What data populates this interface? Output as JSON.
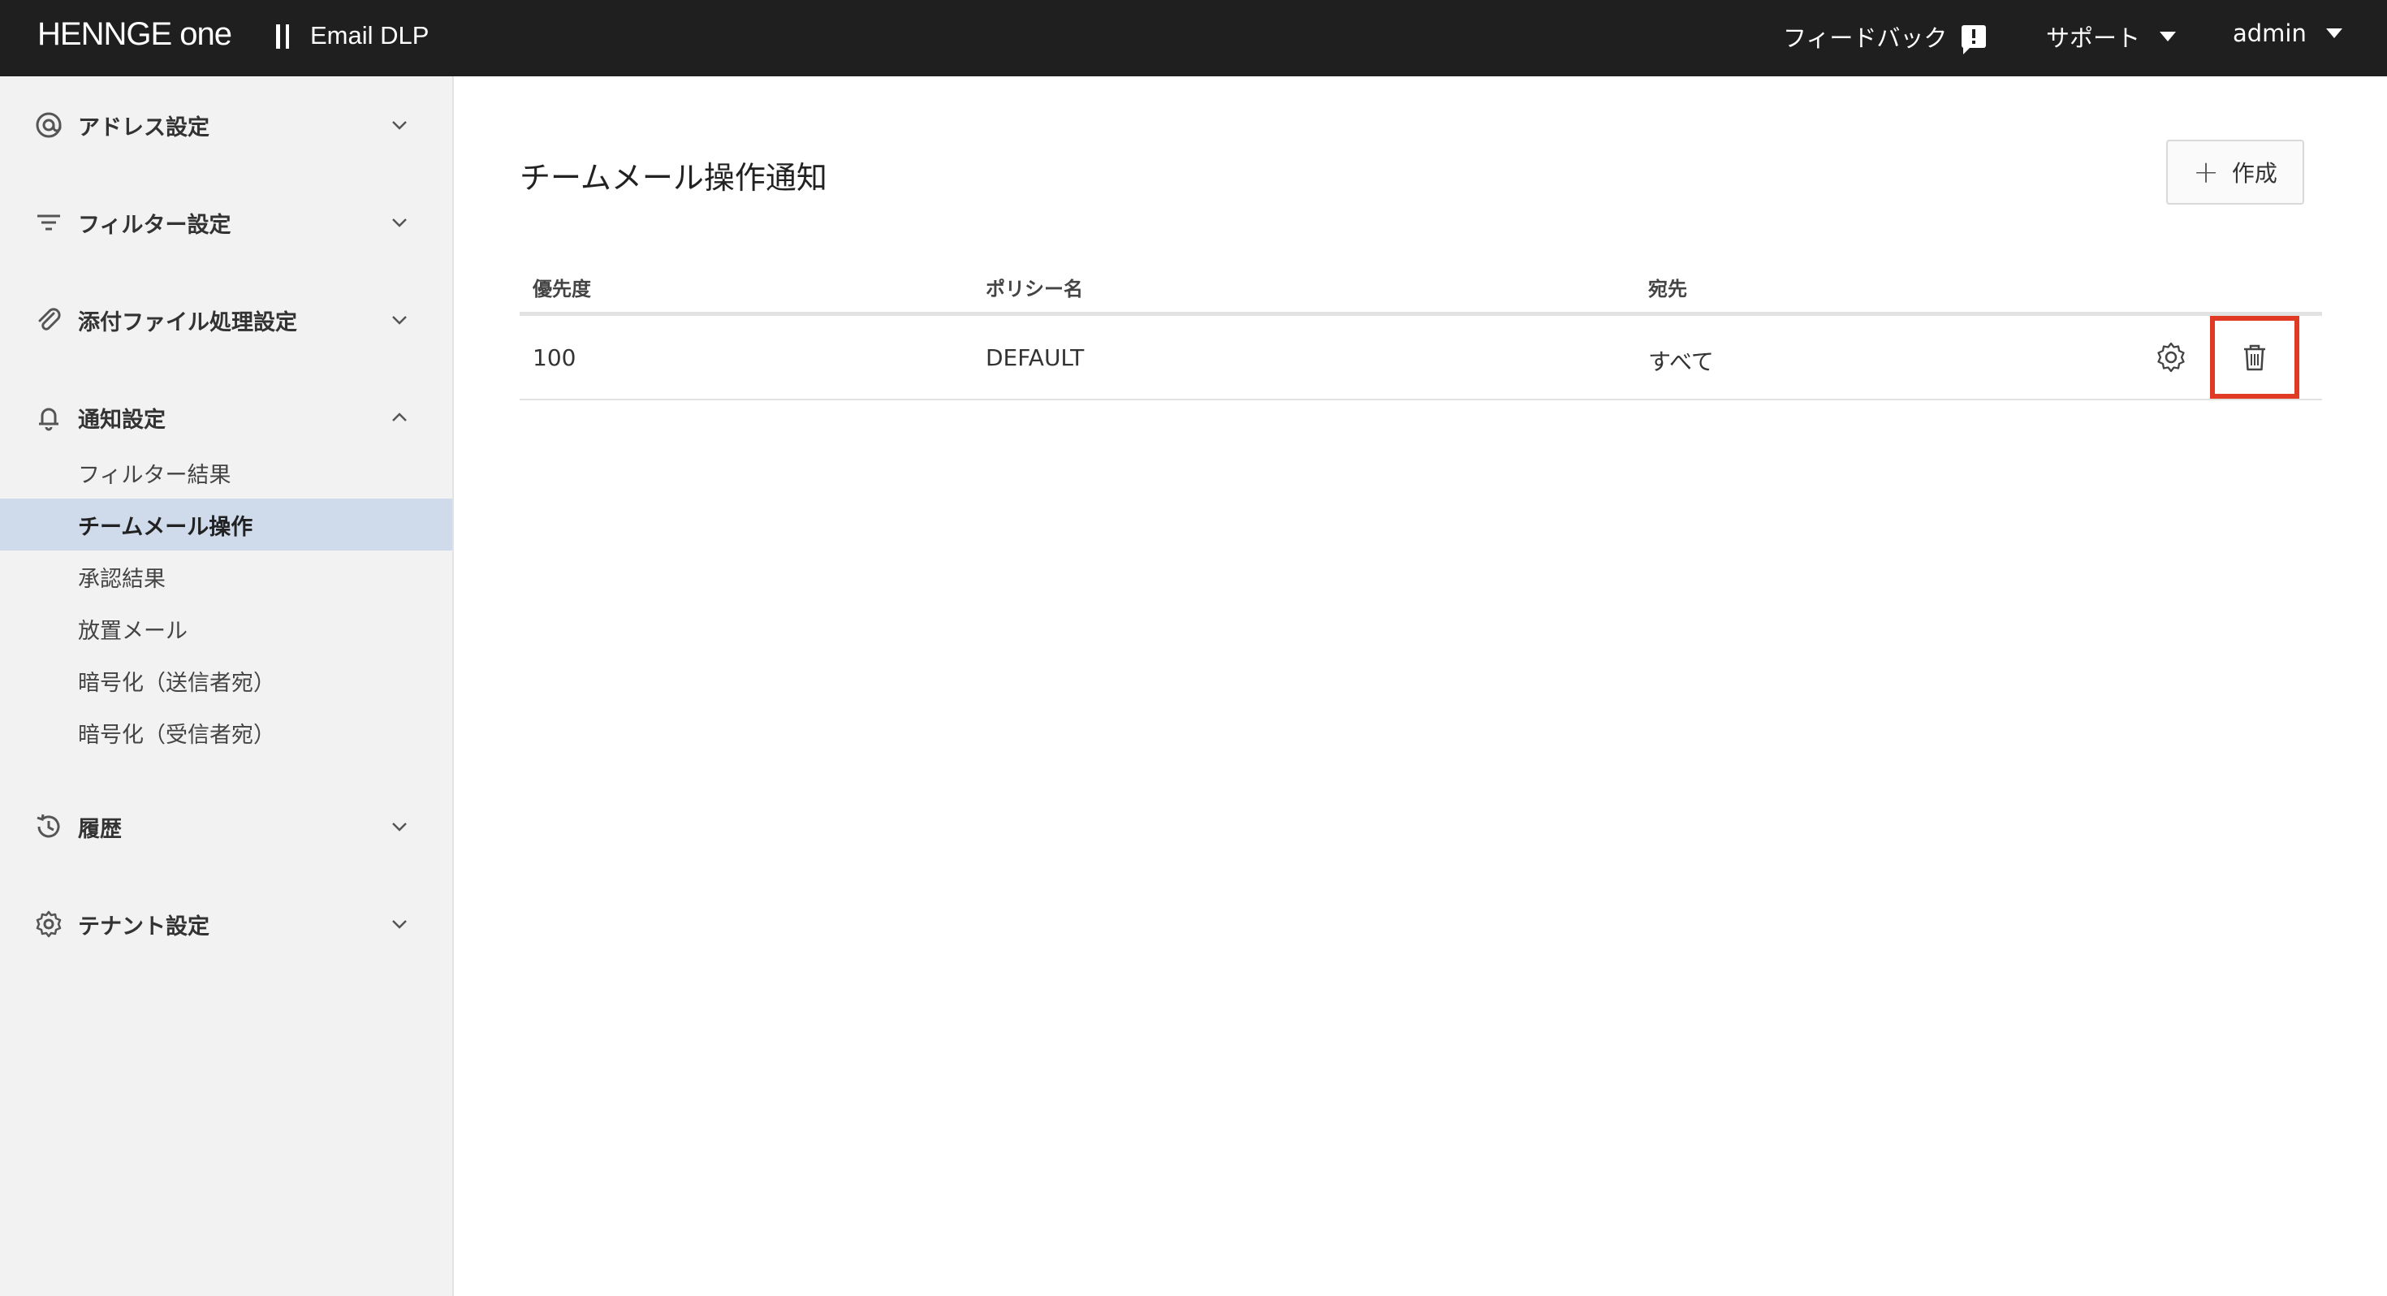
{
  "header": {
    "brand": "HENNGE one",
    "product": "Email DLP",
    "feedback_label": "フィードバック",
    "support_label": "サポート",
    "user_label": "admin"
  },
  "sidebar": {
    "groups": [
      {
        "label": "アドレス設定",
        "icon": "at-icon",
        "expanded": false
      },
      {
        "label": "フィルター設定",
        "icon": "filter-icon",
        "expanded": false
      },
      {
        "label": "添付ファイル処理設定",
        "icon": "paperclip-icon",
        "expanded": false
      },
      {
        "label": "通知設定",
        "icon": "bell-icon",
        "expanded": true
      },
      {
        "label": "履歴",
        "icon": "history-icon",
        "expanded": false
      },
      {
        "label": "テナント設定",
        "icon": "gear-icon",
        "expanded": false
      }
    ],
    "notification_items": [
      {
        "label": "フィルター結果",
        "active": false
      },
      {
        "label": "チームメール操作",
        "active": true
      },
      {
        "label": "承認結果",
        "active": false
      },
      {
        "label": "放置メール",
        "active": false
      },
      {
        "label": "暗号化（送信者宛）",
        "active": false
      },
      {
        "label": "暗号化（受信者宛）",
        "active": false
      }
    ]
  },
  "main": {
    "title": "チームメール操作通知",
    "create_label": "作成",
    "columns": [
      "優先度",
      "ポリシー名",
      "宛先"
    ],
    "rows": [
      {
        "priority": "100",
        "policy": "DEFAULT",
        "recipient": "すべて"
      }
    ]
  },
  "colors": {
    "header_bg": "#1f1f1f",
    "sidebar_bg": "#f2f2f2",
    "active_item_bg": "#cfdbeb",
    "highlight_border": "#e03a24"
  }
}
